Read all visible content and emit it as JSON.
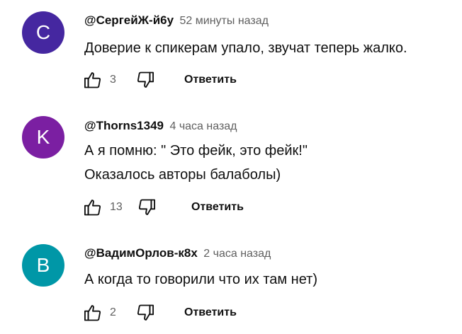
{
  "comments": [
    {
      "avatar_letter": "С",
      "avatar_color": "#4527a0",
      "author": "@СергейЖ-й6у",
      "time": "52 минуты назад",
      "lines": [
        "Доверие к спикерам упало, звучат теперь жалко."
      ],
      "likes": "3",
      "reply_label": "Ответить"
    },
    {
      "avatar_letter": "K",
      "avatar_color": "#7b1fa2",
      "author": "@Thorns1349",
      "time": "4 часа назад",
      "lines": [
        "А я помню: \" Это фейк, это фейк!\"",
        "Оказалось авторы балаболы)"
      ],
      "likes": "13",
      "reply_label": "Ответить"
    },
    {
      "avatar_letter": "B",
      "avatar_color": "#0097a7",
      "author": "@ВадимОрлов-к8х",
      "time": "2 часа назад",
      "lines": [
        "А когда то говорили что их там нет)"
      ],
      "likes": "2",
      "reply_label": "Ответить"
    }
  ]
}
